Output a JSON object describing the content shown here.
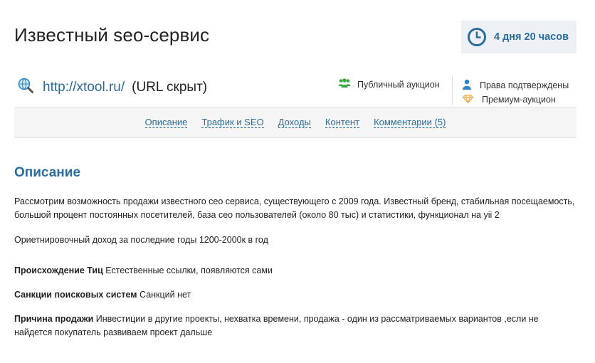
{
  "header": {
    "title": "Известный seo-сервис",
    "timer": "4 дня 20 часов"
  },
  "site": {
    "url": "http://xtool.ru/",
    "url_note": "(URL скрыт)"
  },
  "badges": {
    "auction_type": "Публичный аукцион",
    "rights": "Права подтверждены",
    "premium": "Премиум-аукцион"
  },
  "nav": {
    "items": [
      {
        "label": "Описание"
      },
      {
        "label": "Трафик и SEO"
      },
      {
        "label": "Доходы"
      },
      {
        "label": "Контент"
      },
      {
        "label": "Комментарии (5)"
      }
    ]
  },
  "description": {
    "heading": "Описание",
    "intro": "Рассмотрим возможность продажи известного сео сервиса, существующего с 2009 года. Известный бренд, стабильная посещаемость, большой процент постоянных посетителей, база сео пользователей (около 80 тыс) и статистики, функционал на yii 2",
    "income": "Ориетнировочный доход за последние годы 1200-2000к в год",
    "fields": [
      {
        "label": "Происхождение Тиц",
        "value": "Естественные ссылки, появляются сами"
      },
      {
        "label": "Санкции поисковых систем",
        "value": "Санкций нет"
      },
      {
        "label": "Причина продажи",
        "value": "Инвестиции в другие проекты, нехватка времени, продажа - один из рассматриваемых вариантов ,если не найдется покупатель развиваем проект дальше"
      }
    ]
  },
  "colors": {
    "accent": "#2b6d9b",
    "auction_icon": "#3aa845",
    "user_icon": "#2f86c6",
    "premium_icon": "#e8a33c",
    "timer_bg": "#edf1f5"
  }
}
